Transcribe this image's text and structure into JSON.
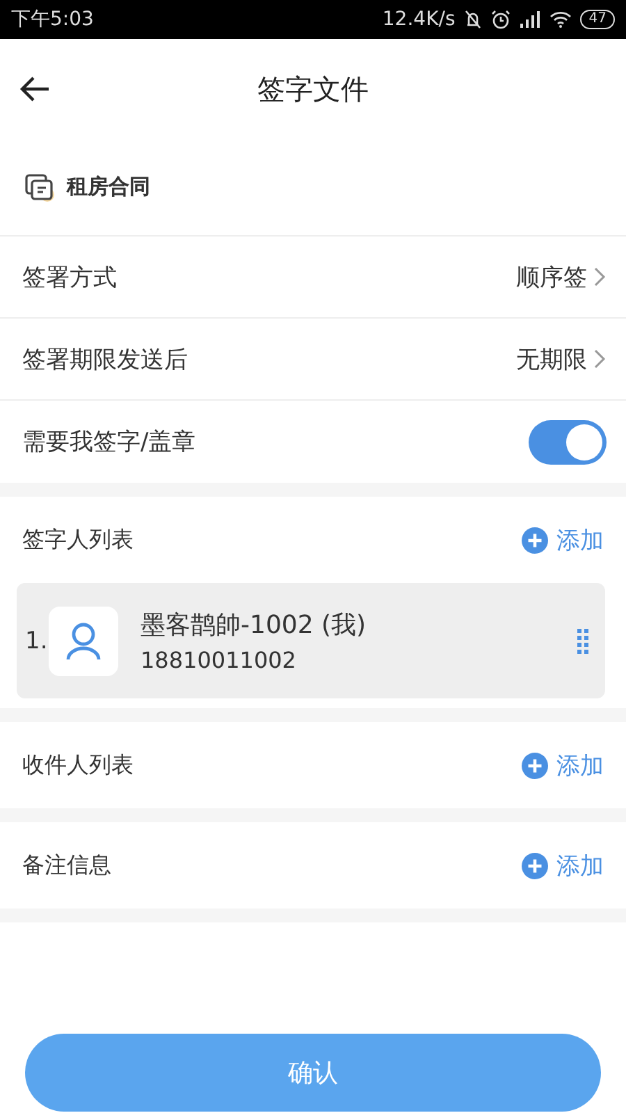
{
  "status_bar": {
    "time": "下午5:03",
    "speed": "12.4K/s",
    "battery": "47"
  },
  "header": {
    "title": "签字文件"
  },
  "document": {
    "name": "租房合同"
  },
  "settings": [
    {
      "kind": "arrow",
      "label": "签署方式",
      "value": "顺序签"
    },
    {
      "kind": "arrow",
      "label": "签署期限发送后",
      "value": "无期限"
    },
    {
      "kind": "toggle",
      "label": "需要我签字/盖章",
      "on": true
    }
  ],
  "signers": {
    "title": "签字人列表",
    "add": "添加",
    "items": [
      {
        "index": "1.",
        "name": "墨客鹊帥-1002 (我)",
        "phone": "18810011002"
      }
    ]
  },
  "recipients": {
    "title": "收件人列表",
    "add": "添加"
  },
  "notes": {
    "title": "备注信息",
    "add": "添加"
  },
  "confirm": "确认"
}
